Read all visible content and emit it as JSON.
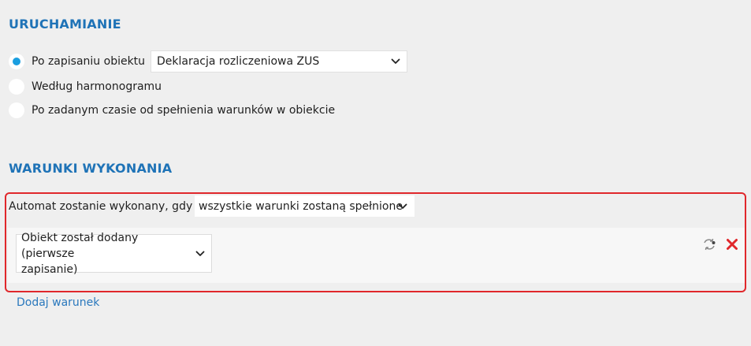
{
  "launch": {
    "title": "URUCHAMIANIE",
    "options": [
      {
        "label": "Po zapisaniu obiektu",
        "selected": true
      },
      {
        "label": "Według harmonogramu",
        "selected": false
      },
      {
        "label": "Po zadanym czasie od spełnienia warunków w obiekcie",
        "selected": false
      }
    ],
    "object_select": {
      "value": "Deklaracja rozliczeniowa ZUS"
    }
  },
  "conditions": {
    "title": "WARUNKI WYKONANIA",
    "intro_label": "Automat zostanie wykonany, gdy",
    "mode_select": {
      "value": "wszystkie warunki zostaną spełnione"
    },
    "items": [
      {
        "value_line1": "Obiekt został dodany (pierwsze",
        "value_line2": "zapisanie)"
      }
    ],
    "add_link": "Dodaj warunek"
  },
  "colors": {
    "accent": "#1f73b7",
    "radio_selected": "#1a9ee0",
    "highlight_frame": "#e0272b",
    "delete_icon": "#e0272b"
  },
  "icons": {
    "chevron": "chevron-down-icon",
    "swap": "swap-icon",
    "delete": "close-icon"
  }
}
